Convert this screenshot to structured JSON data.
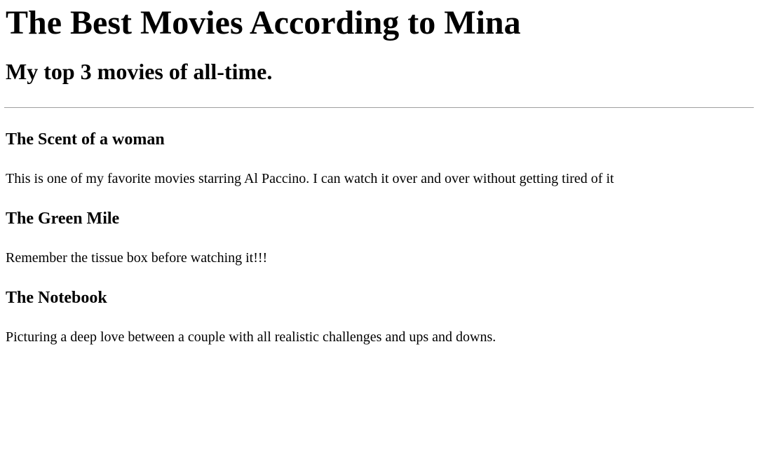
{
  "page": {
    "title": "The Best Movies According to Mina",
    "subtitle": "My top 3 movies of all-time."
  },
  "movies": [
    {
      "title": "The Scent of a woman",
      "description": "This is one of my favorite movies starring Al Paccino. I can watch it over and over without getting tired of it"
    },
    {
      "title": "The Green Mile",
      "description": "Remember the tissue box before watching it!!!"
    },
    {
      "title": "The Notebook",
      "description": "Picturing a deep love between a couple with all realistic challenges and ups and downs."
    }
  ]
}
